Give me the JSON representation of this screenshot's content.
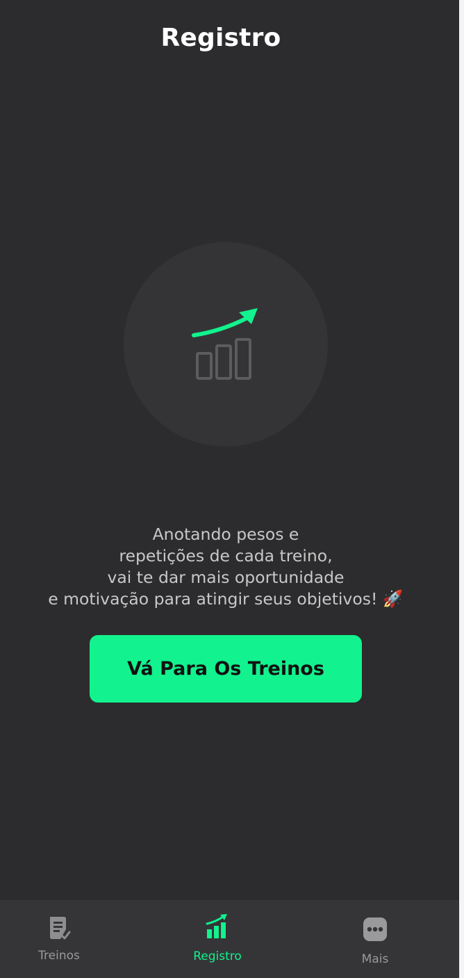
{
  "header": {
    "title": "Registro"
  },
  "empty_state": {
    "icon": "chart-growth-icon",
    "message_lines": [
      "Anotando pesos e",
      "repetições de cada treino,",
      "vai te dar mais oportunidade",
      "e motivação para atingir seus objetivos!"
    ],
    "emoji": "🚀",
    "cta_label": "Vá Para Os Treinos"
  },
  "tabbar": {
    "tabs": [
      {
        "label": "Treinos",
        "icon": "clipboard-check-icon",
        "active": false
      },
      {
        "label": "Registro",
        "icon": "chart-growth-icon",
        "active": true
      },
      {
        "label": "Mais",
        "icon": "more-dots-icon",
        "active": false
      }
    ]
  },
  "colors": {
    "background": "#2c2c2e",
    "accent": "#12f28e",
    "tabbar": "#353537",
    "muted_text": "#c8c8c8"
  }
}
